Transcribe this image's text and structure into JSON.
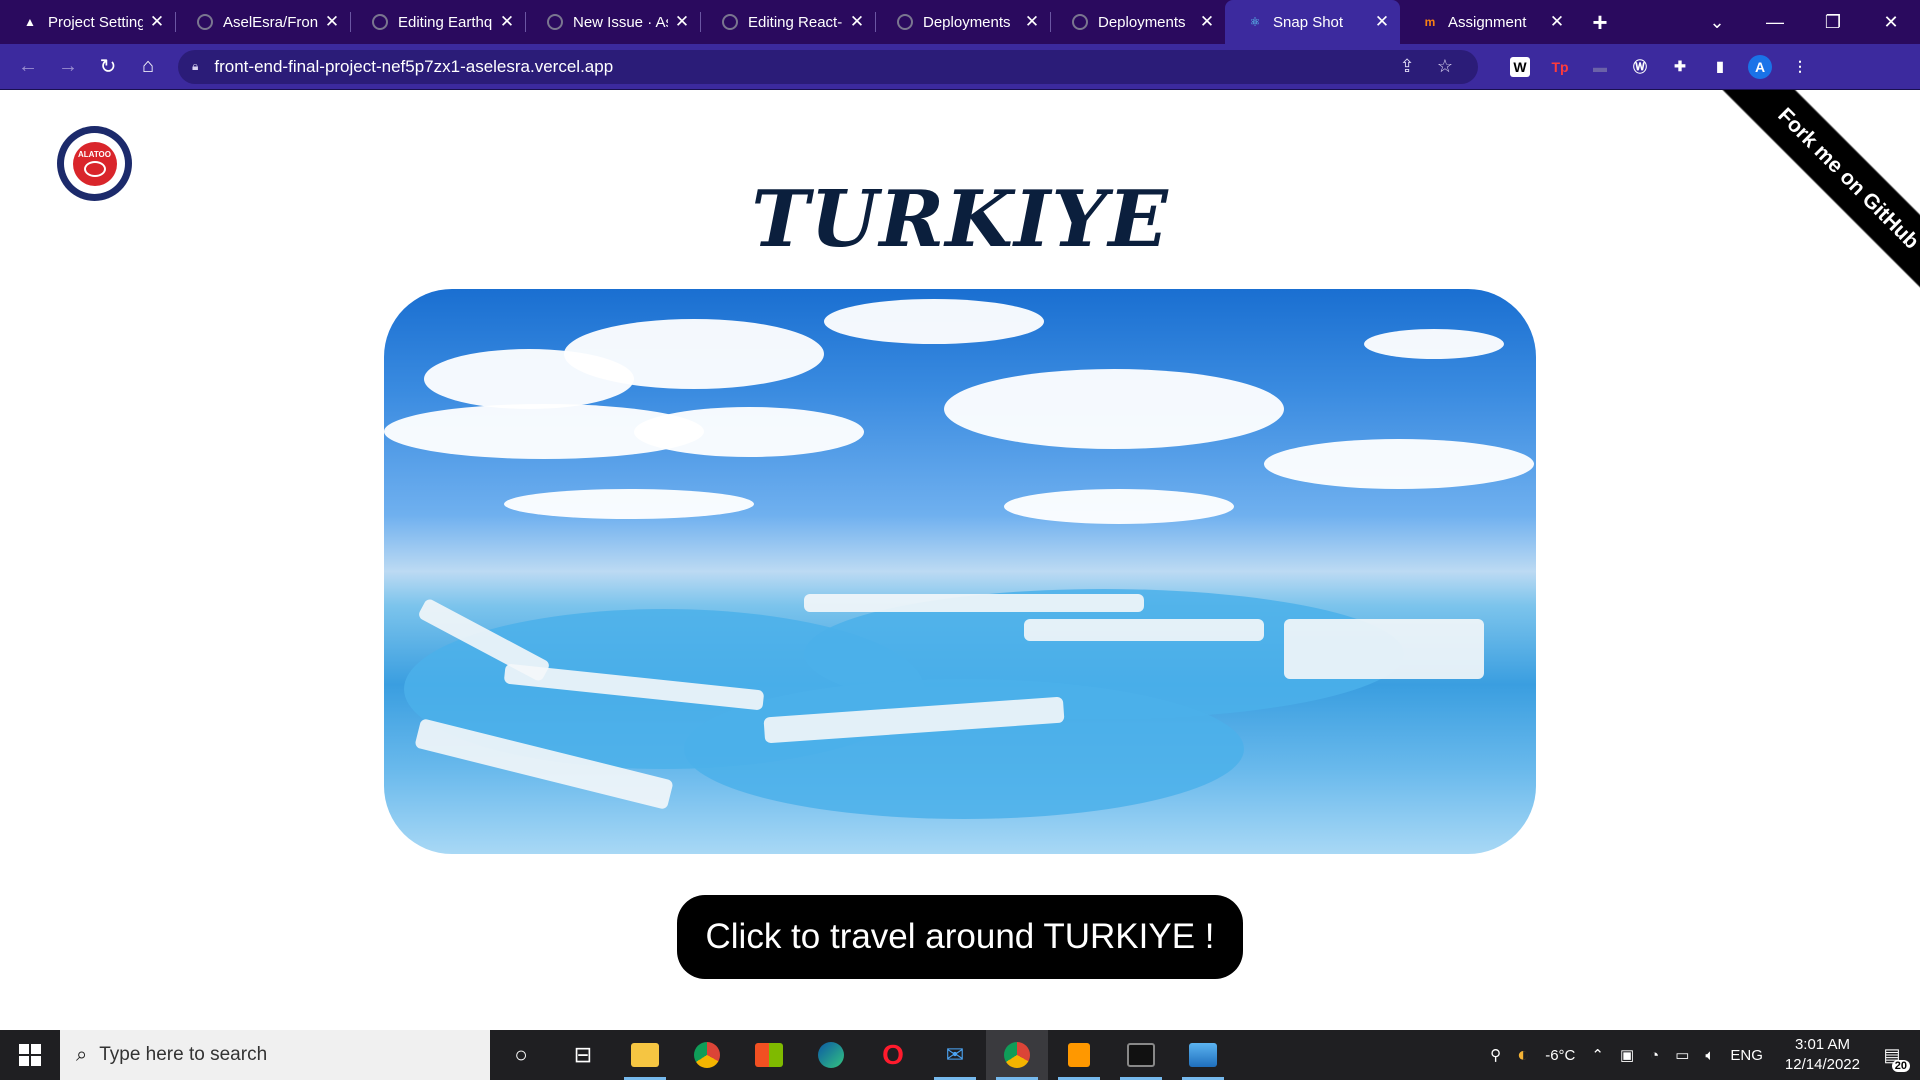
{
  "browser": {
    "tabs": [
      {
        "title": "Project Settings",
        "icon": "vercel-icon",
        "active": false
      },
      {
        "title": "AselEsra/Front",
        "icon": "github-icon",
        "active": false
      },
      {
        "title": "Editing Earthq",
        "icon": "github-icon",
        "active": false
      },
      {
        "title": "New Issue · As",
        "icon": "github-icon",
        "active": false
      },
      {
        "title": "Editing React-",
        "icon": "github-icon",
        "active": false
      },
      {
        "title": "Deployments",
        "icon": "github-icon",
        "active": false
      },
      {
        "title": "Deployments",
        "icon": "github-icon",
        "active": false
      },
      {
        "title": "Snap Shot",
        "icon": "react-icon",
        "active": true
      },
      {
        "title": "Assignment",
        "icon": "moodle-icon",
        "active": false
      }
    ],
    "url": "front-end-final-project-nef5p7zx1-aselesra.vercel.app",
    "profile_initial": "A",
    "extensions": [
      "W",
      "Tp"
    ],
    "accent_color": "#3c2a9e",
    "tabstrip_color": "#2a0a5e"
  },
  "page": {
    "logo_text": "ALATOO",
    "title": "TURKIYE",
    "hero_image_alt": "Pamukkale travertine terraces under a blue sky",
    "cta_label": "Click to travel around TURKIYE !",
    "ribbon_label": "Fork me on GitHub"
  },
  "taskbar": {
    "search_placeholder": "Type here to search",
    "apps": [
      "cortana-icon",
      "task-view-icon",
      "file-explorer-icon",
      "chrome-icon",
      "microsoft-store-icon",
      "edge-icon",
      "opera-icon",
      "mail-icon",
      "chrome-profile-icon",
      "sublime-text-icon",
      "terminal-icon",
      "photos-icon"
    ],
    "temperature": "-6°C",
    "language": "ENG",
    "time": "3:01 AM",
    "date": "12/14/2022",
    "notification_count": "20"
  }
}
